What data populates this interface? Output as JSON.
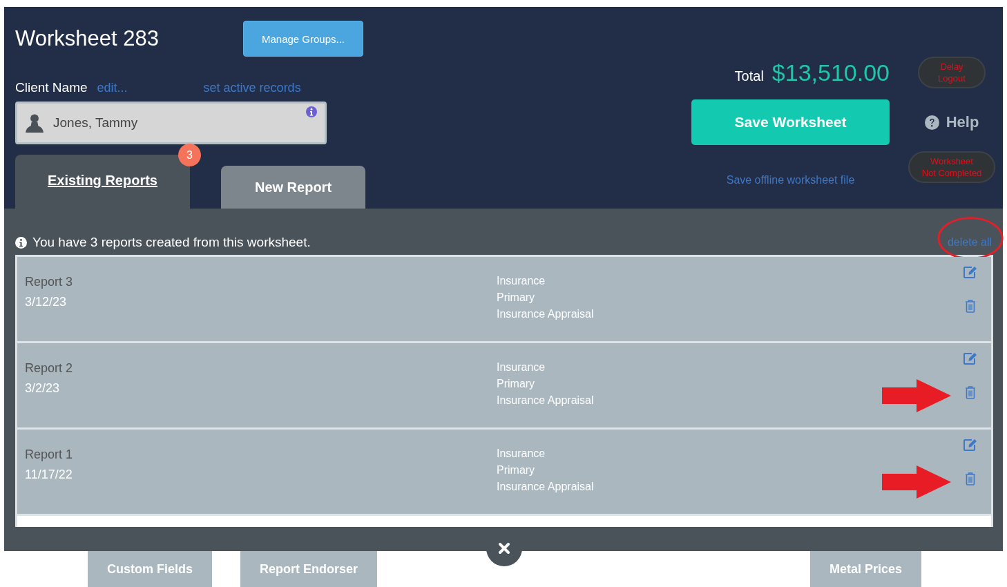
{
  "header": {
    "title": "Worksheet 283",
    "manage_button": "Manage Groups...",
    "client_label": "Client Name",
    "edit_link": "edit...",
    "active_records_link": "set active records",
    "client_value": "Jones, Tammy",
    "total_label": "Total",
    "total_value": "$13,510.00",
    "delay_logout": [
      "Delay",
      "Logout"
    ],
    "save_button": "Save Worksheet",
    "help": "Help",
    "offline_link": "Save offline worksheet file",
    "status": [
      "Worksheet",
      "Not Completed"
    ]
  },
  "tabs": [
    {
      "label": "Existing Reports",
      "selected": true,
      "badge": "3"
    },
    {
      "label": "New Report",
      "selected": false
    }
  ],
  "notice": "You have 3 reports created from this worksheet.",
  "delete_all": {
    "label": "delete all",
    "circled": true
  },
  "reports": [
    {
      "name": "Report 3",
      "date": "3/12/23",
      "details": [
        "Insurance",
        "Primary",
        "Insurance Appraisal"
      ],
      "arrow": false
    },
    {
      "name": "Report 2",
      "date": "3/2/23",
      "details": [
        "Insurance",
        "Primary",
        "Insurance Appraisal"
      ],
      "arrow": true
    },
    {
      "name": "Report 1",
      "date": "11/17/22",
      "details": [
        "Insurance",
        "Primary",
        "Insurance Appraisal"
      ],
      "arrow": true
    }
  ],
  "bottom_tabs_left": [
    "Custom Fields",
    "Report Endorser"
  ],
  "bottom_tabs_right": [
    "Metal Prices"
  ]
}
